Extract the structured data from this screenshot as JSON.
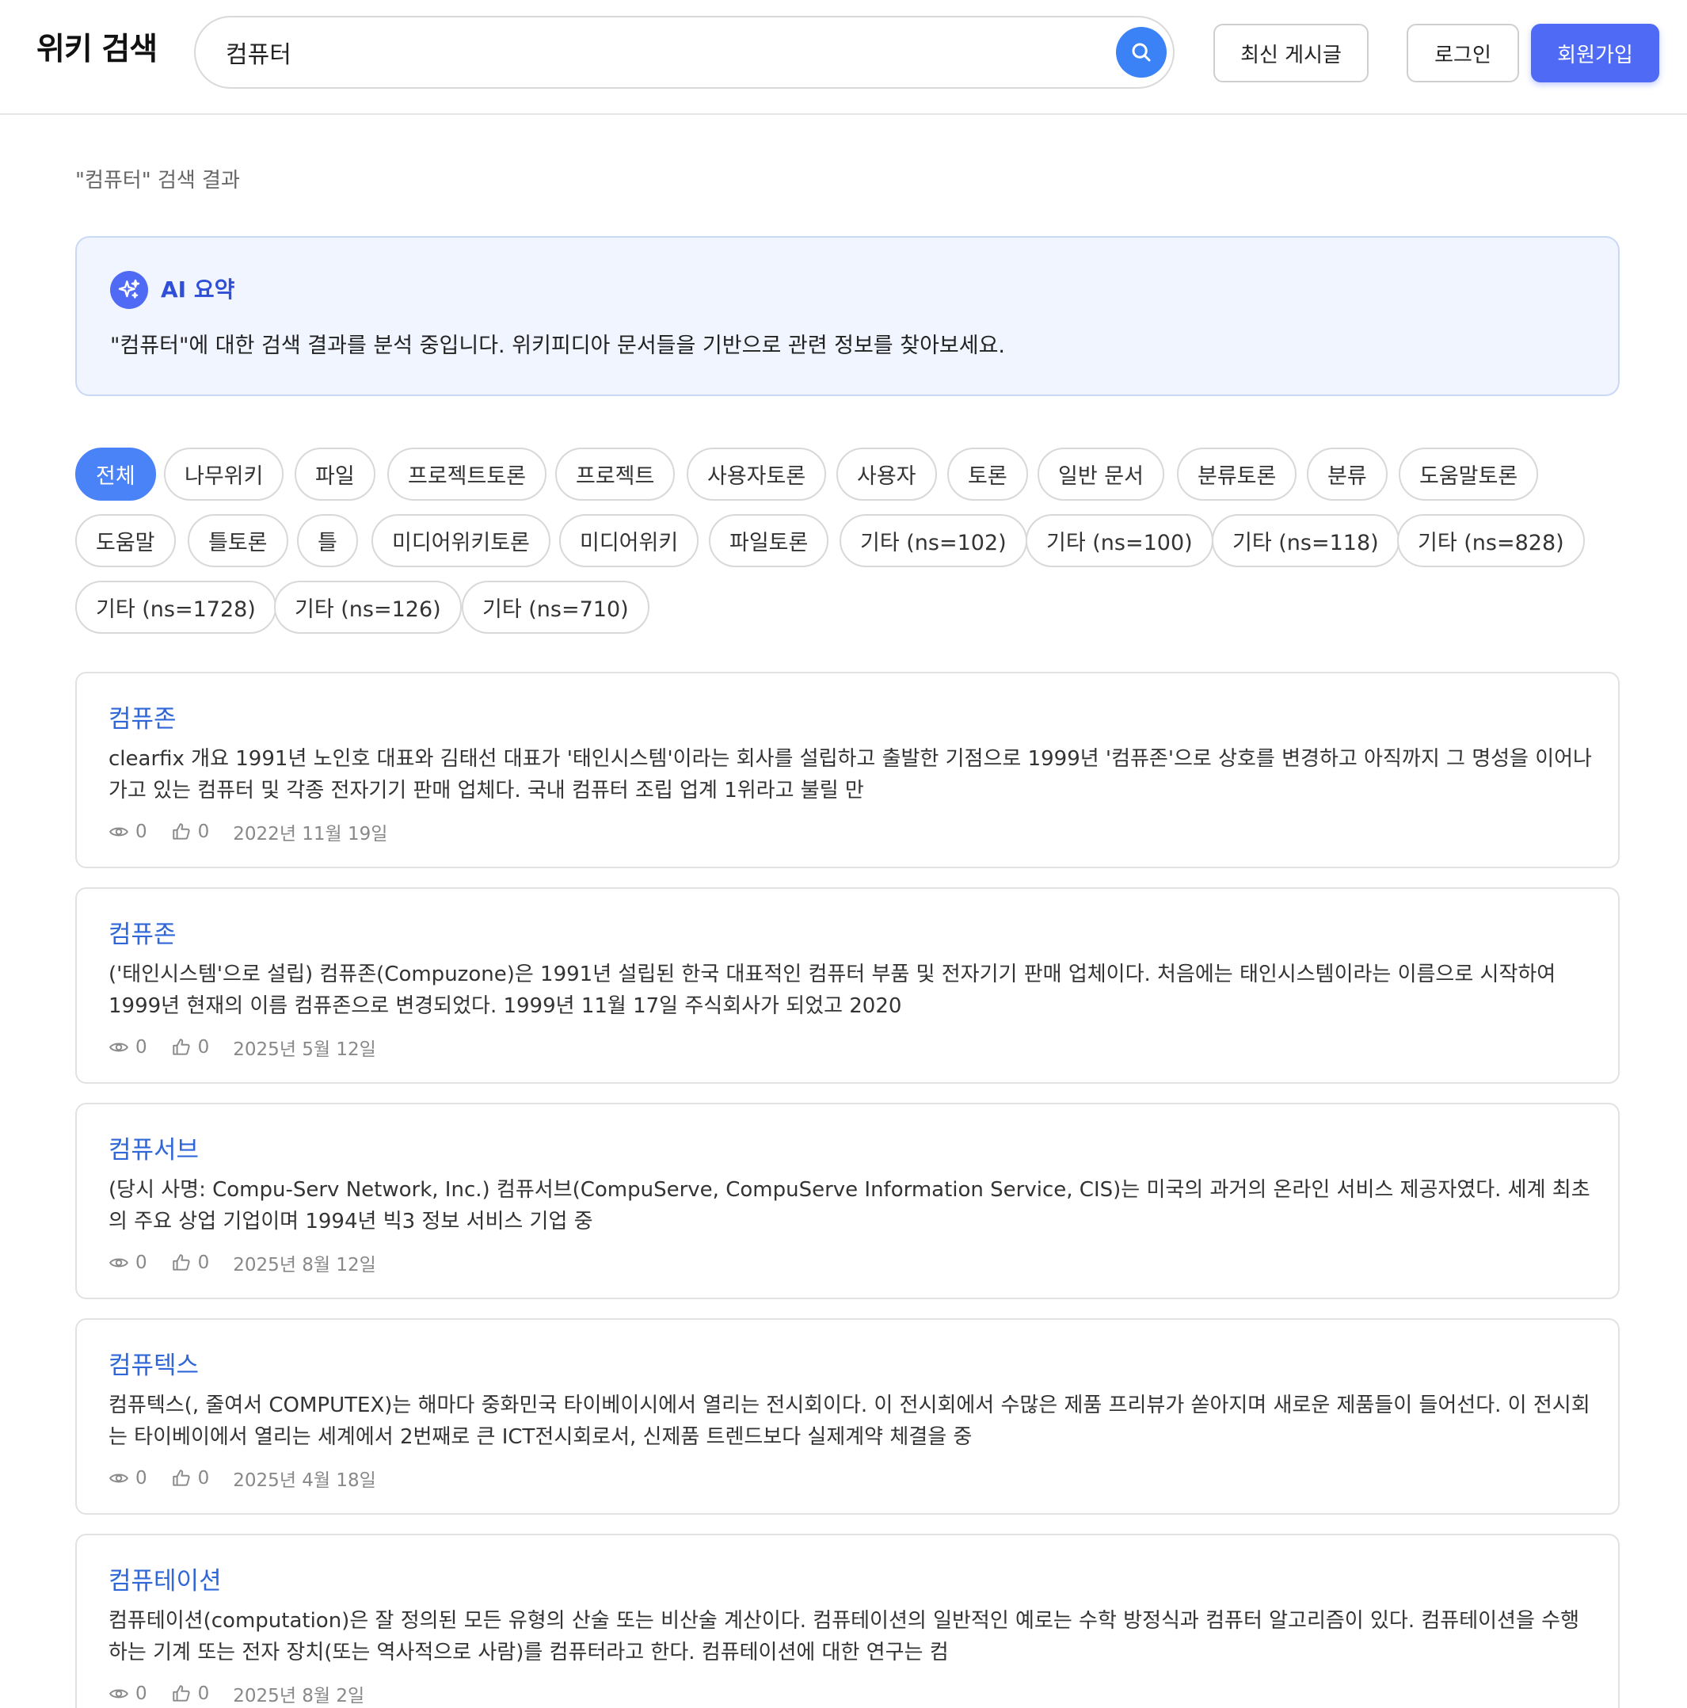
{
  "header": {
    "logo": "위키 검색",
    "search_value": "컴퓨터",
    "recent_label": "최신 게시글",
    "login_label": "로그인",
    "signup_label": "회원가입"
  },
  "results_heading": "\"컴퓨터\" 검색 결과",
  "ai_summary": {
    "title": "AI 요약",
    "text": "\"컴퓨터\"에 대한 검색 결과를 분석 중입니다. 위키피디아 문서들을 기반으로 관련 정보를 찾아보세요."
  },
  "filters": [
    "전체",
    "나무위키",
    "파일",
    "프로젝트토론",
    "프로젝트",
    "사용자토론",
    "사용자",
    "토론",
    "일반 문서",
    "분류토론",
    "분류",
    "도움말토론",
    "도움말",
    "틀토론",
    "틀",
    "미디어위키토론",
    "미디어위키",
    "파일토론",
    "기타 (ns=102)",
    "기타 (ns=100)",
    "기타 (ns=118)",
    "기타 (ns=828)",
    "기타 (ns=1728)",
    "기타 (ns=126)",
    "기타 (ns=710)"
  ],
  "active_filter": "전체",
  "results": [
    {
      "title": "컴퓨존",
      "snippet": "clearfix 개요 1991년 노인호 대표와 김태선 대표가 '태인시스템'이라는 회사를 설립하고 출발한 기점으로 1999년 '컴퓨존'으로 상호를 변경하고 아직까지 그 명성을 이어나가고 있는 컴퓨터 및 각종 전자기기 판매 업체다. 국내 컴퓨터 조립 업계 1위라고 불릴 만",
      "views": "0",
      "likes": "0",
      "date": "2022년 11월 19일"
    },
    {
      "title": "컴퓨존",
      "snippet": "('태인시스템'으로 설립) 컴퓨존(Compuzone)은 1991년 설립된 한국 대표적인 컴퓨터 부품 및 전자기기 판매 업체이다. 처음에는 태인시스템이라는 이름으로 시작하여 1999년 현재의 이름 컴퓨존으로 변경되었다. 1999년 11월 17일 주식회사가 되었고 2020",
      "views": "0",
      "likes": "0",
      "date": "2025년 5월 12일"
    },
    {
      "title": "컴퓨서브",
      "snippet": "(당시 사명: Compu-Serv Network, Inc.) 컴퓨서브(CompuServe, CompuServe Information Service, CIS)는 미국의 과거의 온라인 서비스 제공자였다. 세계 최초의 주요 상업 기업이며 1994년 빅3 정보 서비스 기업 중",
      "views": "0",
      "likes": "0",
      "date": "2025년 8월 12일"
    },
    {
      "title": "컴퓨텍스",
      "snippet": "컴퓨텍스(, 줄여서 COMPUTEX)는 해마다 중화민국 타이베이시에서 열리는 전시회이다. 이 전시회에서 수많은 제품 프리뷰가 쏟아지며 새로운 제품들이 들어선다. 이 전시회는 타이베이에서 열리는 세계에서 2번째로 큰 ICT전시회로서, 신제품 트렌드보다 실제계약 체결을 중",
      "views": "0",
      "likes": "0",
      "date": "2025년 4월 18일"
    },
    {
      "title": "컴퓨테이션",
      "snippet": "컴퓨테이션(computation)은 잘 정의된 모든 유형의 산술 또는 비산술 계산이다. 컴퓨테이션의 일반적인 예로는 수학 방정식과 컴퓨터 알고리즘이 있다. 컴퓨테이션을 수행하는 기계 또는 전자 장치(또는 역사적으로 사람)를 컴퓨터라고 한다. 컴퓨테이션에 대한 연구는 컴",
      "views": "0",
      "likes": "0",
      "date": "2025년 8월 2일"
    }
  ]
}
